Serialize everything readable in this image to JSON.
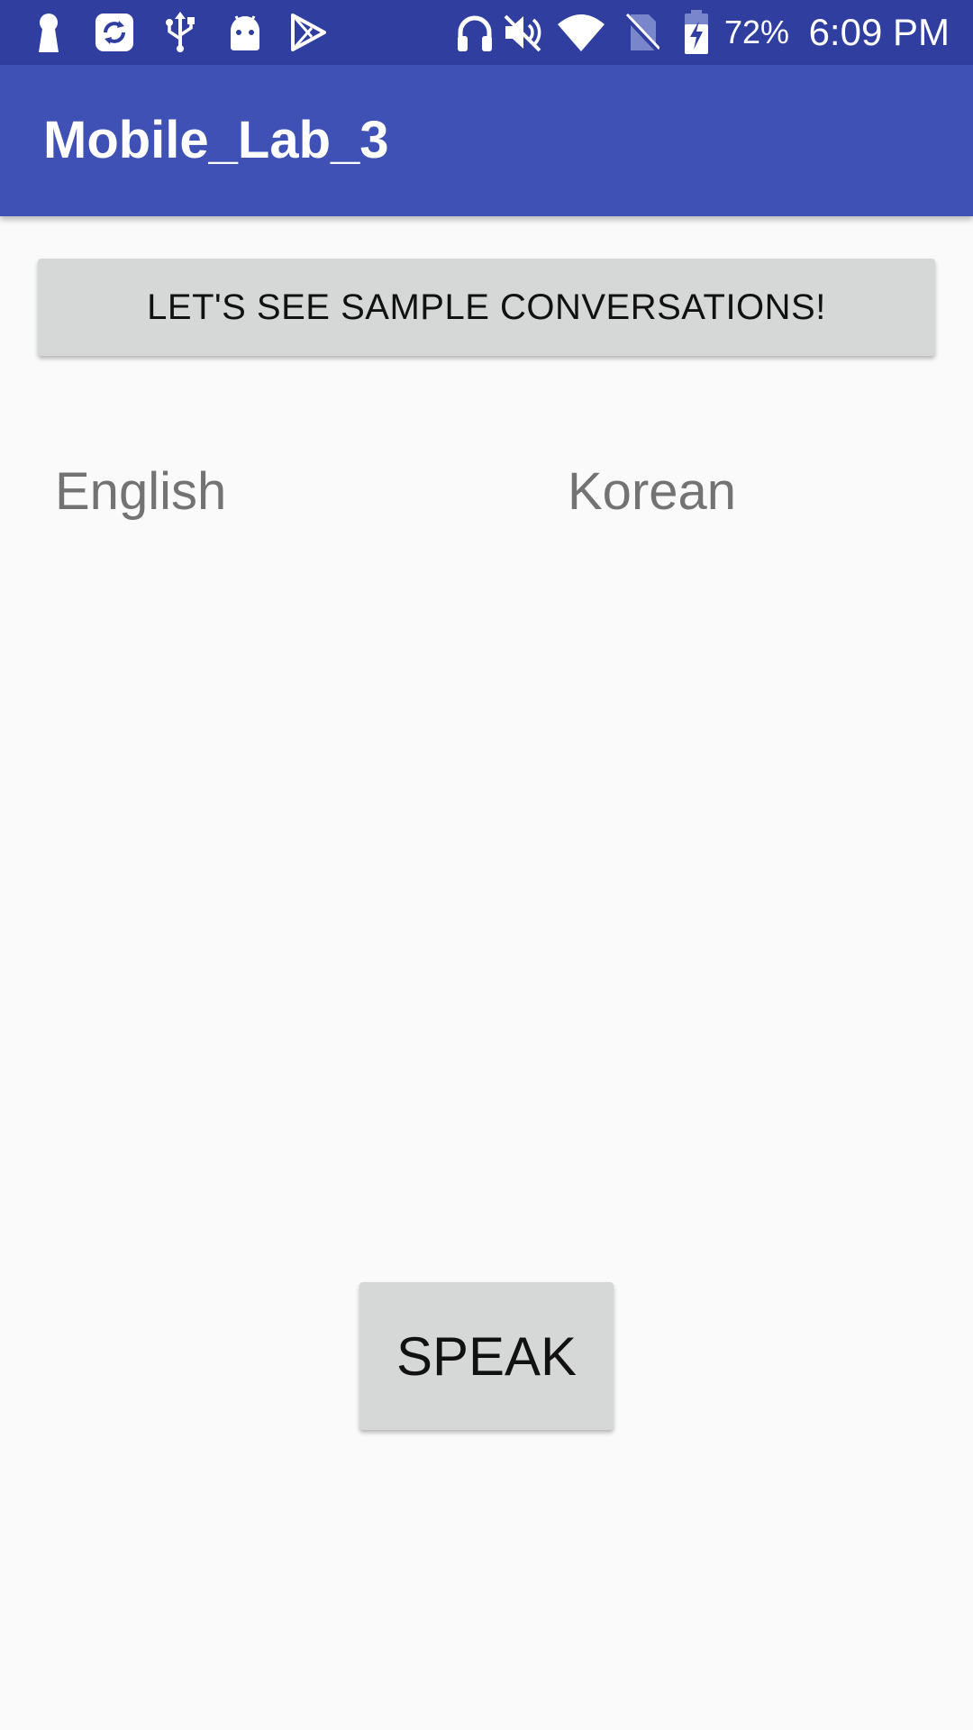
{
  "status_bar": {
    "background": "#303f9f",
    "left_icons": [
      "keyhole-icon",
      "sync-icon",
      "usb-icon",
      "android-icon",
      "play-store-icon"
    ],
    "right_icons": [
      "headphones-icon",
      "mute-icon",
      "wifi-icon",
      "no-sim-icon",
      "battery-charging-icon"
    ],
    "battery_percent": "72%",
    "time": "6:09 PM"
  },
  "app_bar": {
    "title": "Mobile_Lab_3",
    "background": "#3f51b5"
  },
  "main": {
    "sample_button_label": "LET'S SEE SAMPLE CONVERSATIONS!",
    "source_language": "English",
    "target_language": "Korean",
    "speak_button_label": "SPEAK",
    "background": "#fafafa"
  }
}
